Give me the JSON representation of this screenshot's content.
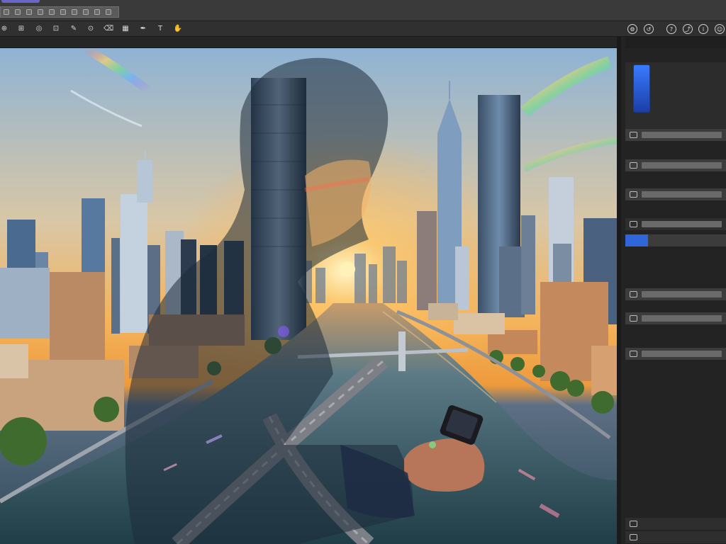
{
  "app": {
    "accent": "#2f66d9",
    "brand_color": "#6a66c8"
  },
  "toolbar": {
    "left_tools": [
      {
        "name": "move-icon",
        "glyph": "⊕"
      },
      {
        "name": "frame-icon",
        "glyph": "⊞"
      },
      {
        "name": "lasso-icon",
        "glyph": "◎"
      },
      {
        "name": "crop-icon",
        "glyph": "⊡"
      },
      {
        "name": "brush-icon",
        "glyph": "✎"
      },
      {
        "name": "stamp-icon",
        "glyph": "⊙"
      },
      {
        "name": "eraser-icon",
        "glyph": "⌫"
      },
      {
        "name": "gradient-icon",
        "glyph": "▦"
      },
      {
        "name": "pen-icon",
        "glyph": "✒"
      },
      {
        "name": "text-icon",
        "glyph": "T"
      },
      {
        "name": "hand-icon",
        "glyph": "✋"
      }
    ],
    "right_tools": [
      {
        "name": "settings-icon",
        "glyph": "⚙"
      },
      {
        "name": "history-icon",
        "glyph": "↺"
      },
      {
        "name": "help-icon",
        "glyph": "?"
      },
      {
        "name": "share-icon",
        "glyph": "⤴"
      },
      {
        "name": "info-icon",
        "glyph": "i"
      },
      {
        "name": "user-icon",
        "glyph": "☺"
      }
    ]
  },
  "document": {
    "name": "",
    "zoom": ""
  },
  "panel": {
    "header_label": "",
    "header_control": "",
    "preview_label": "",
    "sections": [
      {
        "kind": "section",
        "label": ""
      },
      {
        "kind": "row",
        "icon": "",
        "value": "",
        "style": "normal"
      },
      {
        "kind": "section",
        "label": ""
      },
      {
        "kind": "row",
        "icon": "",
        "value": "",
        "style": "normal"
      },
      {
        "kind": "section",
        "label": ""
      },
      {
        "kind": "row",
        "icon": "",
        "value": "",
        "style": "normal"
      },
      {
        "kind": "section",
        "label": ""
      },
      {
        "kind": "row",
        "icon": "",
        "value": "",
        "style": "dark"
      },
      {
        "kind": "row",
        "icon": "",
        "value": "",
        "style": "selected"
      },
      {
        "kind": "section",
        "label": ""
      },
      {
        "kind": "section",
        "label": ""
      },
      {
        "kind": "section",
        "label": ""
      },
      {
        "kind": "row",
        "icon": "",
        "value": "",
        "style": "normal"
      },
      {
        "kind": "row",
        "icon": "",
        "value": "",
        "style": "normal"
      },
      {
        "kind": "section",
        "label": ""
      },
      {
        "kind": "row",
        "icon": "",
        "value": "",
        "style": "normal"
      }
    ],
    "footer_label": "",
    "footer_rows": [
      {
        "icon": "",
        "value": ""
      },
      {
        "icon": "",
        "value": ""
      }
    ]
  }
}
